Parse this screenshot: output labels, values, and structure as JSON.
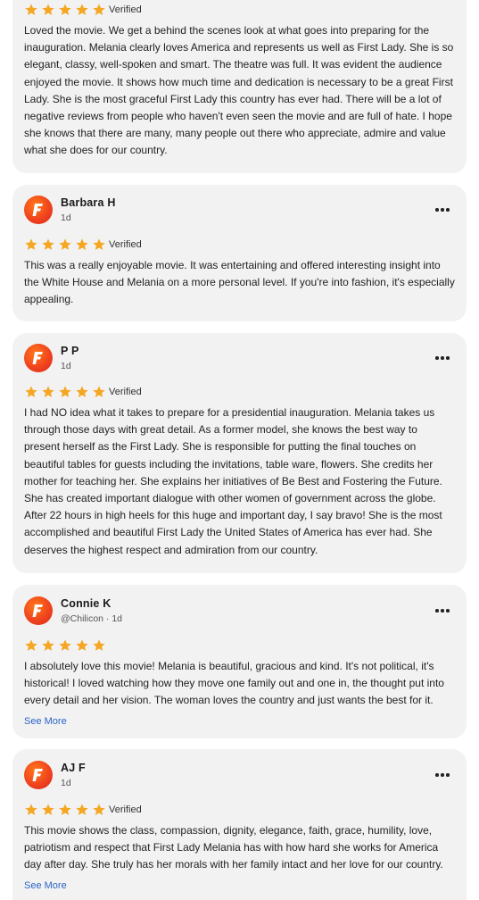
{
  "reviews": [
    {
      "name": "",
      "meta": "",
      "verified": "Verified",
      "stars": 5,
      "text": "Loved the movie. We get a behind the scenes look at what goes into preparing for the inauguration. Melania clearly loves America and represents us well as First Lady. She is so elegant, classy, well-spoken and smart. The theatre was full. It was evident the audience enjoyed the movie. It shows how much time and dedication is necessary to be a great First Lady. She is the most graceful First Lady this country has ever had. There will be a lot of negative reviews from people who haven't even seen the movie and are full of hate. I hope she knows that there are many, many people out there who appreciate, admire and value what she does for our country."
    },
    {
      "name": "Barbara H",
      "meta": "1d",
      "verified": "Verified",
      "stars": 5,
      "text": "This was a really enjoyable movie. It was entertaining and offered interesting insight into the White House and Melania on a more personal level. If you're into fashion, it's especially appealing."
    },
    {
      "name": "P P",
      "meta": "1d",
      "verified": "Verified",
      "stars": 5,
      "text": "I had NO idea what it takes to prepare for a presidential inauguration. Melania takes us through those days with great detail. As a former model, she knows the best way to present herself as the First Lady. She is responsible for putting the final touches on beautiful tables for guests including the invitations, table ware, flowers. She credits her mother for teaching her. She explains her initiatives of Be Best and Fostering the Future. She has created important dialogue with other women of government across the globe. After 22 hours in high heels for this huge and important day, I say bravo! She is the most accomplished and beautiful First Lady the United States of America has ever had. She deserves the highest respect and admiration from our country."
    },
    {
      "name": "Connie K",
      "meta": "@Chilicon · 1d",
      "verified": "",
      "stars": 5,
      "text": "I absolutely love this movie! Melania is beautiful, gracious and kind. It's not political, it's historical! I loved watching how they move one family out and one in, the thought put into every detail and her vision. The woman loves the country and just wants the best for it.",
      "see_more": "See More"
    },
    {
      "name": "AJ F",
      "meta": "1d",
      "verified": "Verified",
      "stars": 5,
      "text": "This movie shows the class, compassion, dignity, elegance, faith, grace, humility, love, patriotism and respect that First Lady Melania has with how hard she works for America day after day. She truly has her morals with her family intact and her love for our country.",
      "see_more": "See More"
    }
  ],
  "colors": {
    "card_bg": "#f2f2f2",
    "star": "#f5a623",
    "link": "#2a64c6",
    "avatar": "#f0441e"
  },
  "icons": {
    "avatar": "fandango-f-logo-icon",
    "menu": "more-dots-icon",
    "star": "star-icon"
  }
}
